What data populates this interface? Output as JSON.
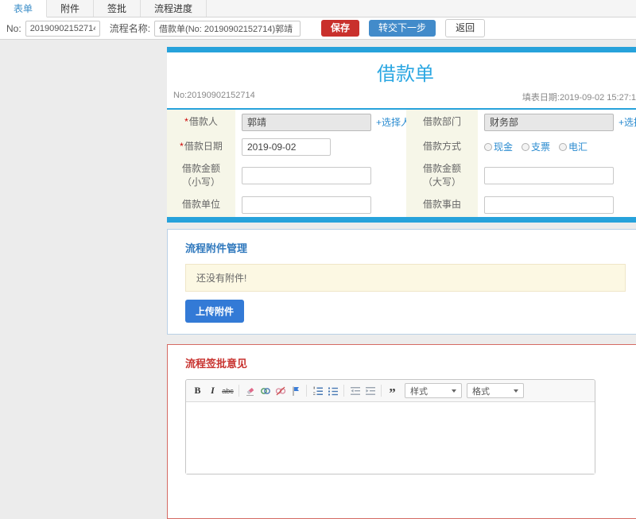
{
  "colors": {
    "accent_blue": "#27a2db",
    "save_red": "#c9302c",
    "primary_blue": "#428bca",
    "section_red": "#c8332f",
    "section_blue": "#2f78bd"
  },
  "tabs": [
    {
      "label": "表单",
      "active": true
    },
    {
      "label": "附件",
      "active": false
    },
    {
      "label": "签批",
      "active": false
    },
    {
      "label": "流程进度",
      "active": false
    }
  ],
  "toolbar": {
    "no_label": "No:",
    "no_value": "20190902152714",
    "process_label": "流程名称:",
    "process_value": "借款单(No: 20190902152714)郭靖",
    "save_label": "保存",
    "next_label": "转交下一步",
    "back_label": "返回"
  },
  "form": {
    "title": "借款单",
    "no_text": "No:20190902152714",
    "date_text": "填表日期:2019-09-02 15:27:1",
    "required_mark": "*",
    "rows": [
      {
        "left": {
          "label": "借款人",
          "value": "郭靖",
          "link": "+选择人员"
        },
        "right": {
          "label": "借款部门",
          "value": "财务部",
          "link": "+选择部门"
        }
      },
      {
        "left": {
          "label": "借款日期",
          "value": "2019-09-02"
        },
        "right": {
          "label": "借款方式",
          "options": [
            "现金",
            "支票",
            "电汇"
          ]
        }
      },
      {
        "left": {
          "label": "借款金额（小写）"
        },
        "right": {
          "label": "借款金额（大写）"
        }
      },
      {
        "left": {
          "label": "借款单位"
        },
        "right": {
          "label": "借款事由"
        }
      }
    ]
  },
  "attachments": {
    "title": "流程附件管理",
    "empty_text": "还没有附件!",
    "upload_label": "上传附件"
  },
  "approval": {
    "title": "流程签批意见",
    "editor": {
      "bold": "B",
      "italic": "I",
      "strike": "abc",
      "quote": "”",
      "styles_label": "样式",
      "format_label": "格式"
    }
  }
}
